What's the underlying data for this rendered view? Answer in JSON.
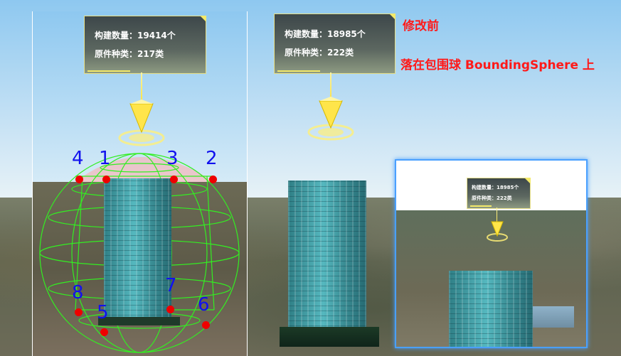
{
  "left_panel": {
    "info": {
      "count_label": "构建数量：",
      "count_value": "19414个",
      "types_label": "原件种类：",
      "types_value": "217类"
    },
    "vertex_labels": [
      {
        "text": "4"
      },
      {
        "text": "1"
      },
      {
        "text": "3"
      },
      {
        "text": "2"
      },
      {
        "text": "8"
      },
      {
        "text": "5"
      },
      {
        "text": "7"
      },
      {
        "text": "6"
      }
    ]
  },
  "middle": {
    "info": {
      "count_label": "构建数量：",
      "count_value": "18985个",
      "types_label": "原件种类：",
      "types_value": "222类"
    }
  },
  "inset": {
    "info": {
      "count_label": "构建数量：",
      "count_value": "18985个",
      "types_label": "原件种类：",
      "types_value": "222类"
    }
  },
  "annotations": {
    "before": "修改前",
    "on_sphere": "落在包围球 BoundingSphere 上"
  },
  "colors": {
    "annotation": "#ff1a1a",
    "vertex_label": "#1111ee",
    "wireframe": "#33ee22",
    "inset_border": "#4aa0ff",
    "marker": "#ffe54a"
  }
}
